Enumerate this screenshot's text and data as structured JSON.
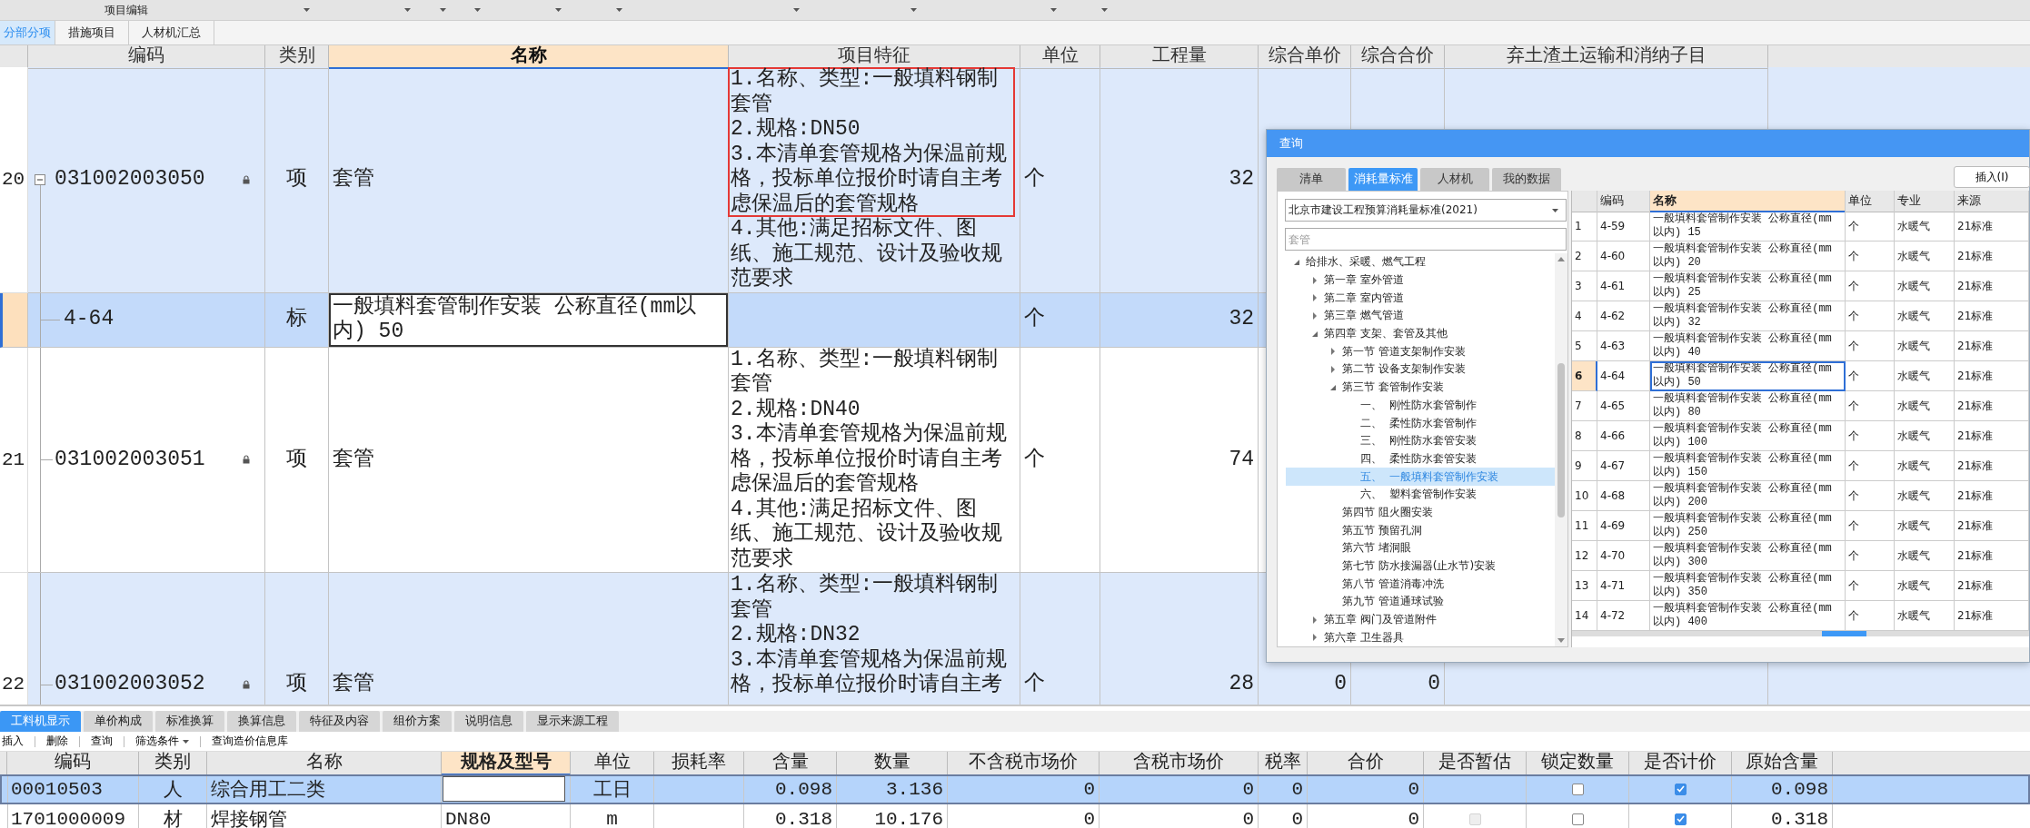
{
  "toolbar": {
    "title": "项目编辑"
  },
  "tabs": [
    {
      "label": "分部分项",
      "selected": true
    },
    {
      "label": "措施项目",
      "selected": false
    },
    {
      "label": "人材机汇总",
      "selected": false
    }
  ],
  "table": {
    "columns": [
      {
        "label": "编码",
        "selected": false
      },
      {
        "label": "类别",
        "selected": false
      },
      {
        "label": "名称",
        "selected": true
      },
      {
        "label": "项目特征",
        "selected": false
      },
      {
        "label": "单位",
        "selected": false
      },
      {
        "label": "工程量",
        "selected": false
      },
      {
        "label": "综合单价",
        "selected": false
      },
      {
        "label": "综合合价",
        "selected": false
      },
      {
        "label": "弃土渣土运输和消纳子目",
        "selected": false
      }
    ],
    "rows": [
      {
        "kind": "item",
        "number": "20",
        "code": "031002003050",
        "expanded": true,
        "locked": true,
        "type": "项",
        "name": "套管",
        "features": [
          {
            "text": "1.名称、类型:一般填料钢制套管",
            "boxed": true
          },
          {
            "text": "2.规格:DN50",
            "boxed": true
          },
          {
            "text": "3.本清单套管规格为保温前规格，投标单位报价时请自主考虑保温后的套管规格",
            "boxed": true
          },
          {
            "text": "4.其他:满足招标文件、图纸、施工规范、设计及验收规范要求",
            "boxed": false
          }
        ],
        "unit": "个",
        "quantity": "32",
        "highlighted": true,
        "selected": false
      },
      {
        "kind": "sub",
        "code": "4-64",
        "type": "标",
        "name": "一般填料套管制作安装 公称直径(mm以内) 50",
        "unit": "个",
        "quantity": "32",
        "highlighted": false,
        "selected": true
      },
      {
        "kind": "item",
        "number": "21",
        "code": "031002003051",
        "locked": true,
        "type": "项",
        "name": "套管",
        "features": [
          {
            "text": "1.名称、类型:一般填料钢制套管",
            "boxed": false
          },
          {
            "text": "2.规格:DN40",
            "boxed": false
          },
          {
            "text": "3.本清单套管规格为保温前规格，投标单位报价时请自主考虑保温后的套管规格",
            "boxed": false
          },
          {
            "text": "4.其他:满足招标文件、图纸、施工规范、设计及验收规范要求",
            "boxed": false
          }
        ],
        "unit": "个",
        "quantity": "74",
        "highlighted": false,
        "selected": false
      },
      {
        "kind": "item",
        "number": "22",
        "code": "031002003052",
        "locked": true,
        "type": "项",
        "name": "套管",
        "features": [
          {
            "text": "1.名称、类型:一般填料钢制套管",
            "boxed": false
          },
          {
            "text": "2.规格:DN32",
            "boxed": false
          },
          {
            "text": "3.本清单套管规格为保温前规格，投标单位报价时请自主考",
            "boxed": false
          }
        ],
        "unit": "个",
        "quantity": "28",
        "unit_price": "0",
        "total_price": "0",
        "highlighted": true,
        "selected": false
      }
    ]
  },
  "query_dialog": {
    "title": "查询",
    "tabs": [
      {
        "label": "清单",
        "selected": false
      },
      {
        "label": "消耗量标准",
        "selected": true
      },
      {
        "label": "人材机",
        "selected": false
      },
      {
        "label": "我的数据",
        "selected": false
      }
    ],
    "insert_button": "插入(I)",
    "library_select": "北京市建设工程预算消耗量标准(2021)",
    "search": {
      "placeholder": "套管"
    },
    "tree": [
      {
        "label": "给排水、采暖、燃气工程",
        "kind": "branch",
        "expanded": true,
        "selected": false,
        "children": [
          {
            "label": "第一章 室外管道",
            "kind": "branch",
            "expanded": false,
            "selected": false
          },
          {
            "label": "第二章 室内管道",
            "kind": "branch",
            "expanded": false,
            "selected": false
          },
          {
            "label": "第三章 燃气管道",
            "kind": "branch",
            "expanded": false,
            "selected": false
          },
          {
            "label": "第四章 支架、套管及其他",
            "kind": "branch",
            "expanded": true,
            "selected": false,
            "children": [
              {
                "label": "第一节 管道支架制作安装",
                "kind": "branch",
                "expanded": false,
                "selected": false
              },
              {
                "label": "第二节 设备支架制作安装",
                "kind": "branch",
                "expanded": false,
                "selected": false
              },
              {
                "label": "第三节 套管制作安装",
                "kind": "branch",
                "expanded": true,
                "selected": false,
                "children": [
                  {
                    "label": "一、  刚性防水套管制作",
                    "kind": "leaf",
                    "selected": false
                  },
                  {
                    "label": "二、  柔性防水套管制作",
                    "kind": "leaf",
                    "selected": false
                  },
                  {
                    "label": "三、  刚性防水套管安装",
                    "kind": "leaf",
                    "selected": false
                  },
                  {
                    "label": "四、  柔性防水套管安装",
                    "kind": "leaf",
                    "selected": false
                  },
                  {
                    "label": "五、  一般填料套管制作安装",
                    "kind": "leaf",
                    "selected": true
                  },
                  {
                    "label": "六、  塑料套管制作安装",
                    "kind": "leaf",
                    "selected": false
                  }
                ]
              },
              {
                "label": "第四节 阻火圈安装",
                "kind": "leaf",
                "selected": false
              },
              {
                "label": "第五节 预留孔洞",
                "kind": "leaf",
                "selected": false
              },
              {
                "label": "第六节 堵洞眼",
                "kind": "leaf",
                "selected": false
              },
              {
                "label": "第七节 防水接漏器(止水节)安装",
                "kind": "leaf",
                "selected": false
              },
              {
                "label": "第八节 管道消毒冲洗",
                "kind": "leaf",
                "selected": false
              },
              {
                "label": "第九节 管道通球试验",
                "kind": "leaf",
                "selected": false
              }
            ]
          },
          {
            "label": "第五章 阀门及管道附件",
            "kind": "branch",
            "expanded": false,
            "selected": false
          },
          {
            "label": "第六章 卫生器具",
            "kind": "branch",
            "expanded": false,
            "selected": false
          }
        ]
      }
    ],
    "table": {
      "columns": [
        {
          "label": "编码",
          "selected": false
        },
        {
          "label": "名称",
          "selected": true
        },
        {
          "label": "单位",
          "selected": false
        },
        {
          "label": "专业",
          "selected": false
        },
        {
          "label": "来源",
          "selected": false
        }
      ],
      "rows": [
        {
          "number": "1",
          "code": "4-59",
          "name": "一般填料套管制作安装 公称直径(mm以内) 15",
          "unit": "个",
          "specialty": "水暖气",
          "source": "21标准",
          "selected": false
        },
        {
          "number": "2",
          "code": "4-60",
          "name": "一般填料套管制作安装 公称直径(mm以内) 20",
          "unit": "个",
          "specialty": "水暖气",
          "source": "21标准",
          "selected": false
        },
        {
          "number": "3",
          "code": "4-61",
          "name": "一般填料套管制作安装 公称直径(mm以内) 25",
          "unit": "个",
          "specialty": "水暖气",
          "source": "21标准",
          "selected": false
        },
        {
          "number": "4",
          "code": "4-62",
          "name": "一般填料套管制作安装 公称直径(mm以内) 32",
          "unit": "个",
          "specialty": "水暖气",
          "source": "21标准",
          "selected": false
        },
        {
          "number": "5",
          "code": "4-63",
          "name": "一般填料套管制作安装 公称直径(mm以内) 40",
          "unit": "个",
          "specialty": "水暖气",
          "source": "21标准",
          "selected": false
        },
        {
          "number": "6",
          "code": "4-64",
          "name": "一般填料套管制作安装 公称直径(mm以内) 50",
          "unit": "个",
          "specialty": "水暖气",
          "source": "21标准",
          "selected": true
        },
        {
          "number": "7",
          "code": "4-65",
          "name": "一般填料套管制作安装 公称直径(mm以内) 80",
          "unit": "个",
          "specialty": "水暖气",
          "source": "21标准",
          "selected": false
        },
        {
          "number": "8",
          "code": "4-66",
          "name": "一般填料套管制作安装 公称直径(mm以内) 100",
          "unit": "个",
          "specialty": "水暖气",
          "source": "21标准",
          "selected": false
        },
        {
          "number": "9",
          "code": "4-67",
          "name": "一般填料套管制作安装 公称直径(mm以内) 150",
          "unit": "个",
          "specialty": "水暖气",
          "source": "21标准",
          "selected": false
        },
        {
          "number": "10",
          "code": "4-68",
          "name": "一般填料套管制作安装 公称直径(mm以内) 200",
          "unit": "个",
          "specialty": "水暖气",
          "source": "21标准",
          "selected": false
        },
        {
          "number": "11",
          "code": "4-69",
          "name": "一般填料套管制作安装 公称直径(mm以内) 250",
          "unit": "个",
          "specialty": "水暖气",
          "source": "21标准",
          "selected": false
        },
        {
          "number": "12",
          "code": "4-70",
          "name": "一般填料套管制作安装 公称直径(mm以内) 300",
          "unit": "个",
          "specialty": "水暖气",
          "source": "21标准",
          "selected": false
        },
        {
          "number": "13",
          "code": "4-71",
          "name": "一般填料套管制作安装 公称直径(mm以内) 350",
          "unit": "个",
          "specialty": "水暖气",
          "source": "21标准",
          "selected": false
        },
        {
          "number": "14",
          "code": "4-72",
          "name": "一般填料套管制作安装 公称直径(mm以内) 400",
          "unit": "个",
          "specialty": "水暖气",
          "source": "21标准",
          "selected": false
        }
      ]
    }
  },
  "detail_panel": {
    "tabs": [
      {
        "label": "工料机显示",
        "selected": true
      },
      {
        "label": "单价构成",
        "selected": false
      },
      {
        "label": "标准换算",
        "selected": false
      },
      {
        "label": "换算信息",
        "selected": false
      },
      {
        "label": "特征及内容",
        "selected": false
      },
      {
        "label": "组价方案",
        "selected": false
      },
      {
        "label": "说明信息",
        "selected": false
      },
      {
        "label": "显示来源工程",
        "selected": false
      }
    ],
    "toolbar": [
      {
        "label": "插入",
        "dropdown": false
      },
      {
        "label": "删除",
        "dropdown": false
      },
      {
        "label": "查询",
        "dropdown": false
      },
      {
        "label": "筛选条件",
        "dropdown": true
      },
      {
        "label": "查询造价信息库",
        "dropdown": false
      }
    ],
    "table": {
      "columns": [
        {
          "label": "编码",
          "selected": false
        },
        {
          "label": "类别",
          "selected": false
        },
        {
          "label": "名称",
          "selected": false
        },
        {
          "label": "规格及型号",
          "selected": true
        },
        {
          "label": "单位",
          "selected": false
        },
        {
          "label": "损耗率",
          "selected": false
        },
        {
          "label": "含量",
          "selected": false
        },
        {
          "label": "数量",
          "selected": false
        },
        {
          "label": "不含税市场价",
          "selected": false
        },
        {
          "label": "含税市场价",
          "selected": false
        },
        {
          "label": "税率",
          "selected": false
        },
        {
          "label": "合价",
          "selected": false
        },
        {
          "label": "是否暂估",
          "selected": false
        },
        {
          "label": "锁定数量",
          "selected": false
        },
        {
          "label": "是否计价",
          "selected": false
        },
        {
          "label": "原始含量",
          "selected": false
        }
      ],
      "rows": [
        {
          "selected": true,
          "cells": [
            "00010503",
            "人",
            "综合用工二类",
            {
              "kind": "input"
            },
            "工日",
            null,
            "0.098",
            "3.136",
            "0",
            "0",
            "0",
            "0",
            null,
            {
              "kind": "checkbox",
              "checked": false,
              "disabled": false
            },
            {
              "kind": "checkbox",
              "checked": true,
              "disabled": false
            },
            "0.098"
          ]
        },
        {
          "selected": false,
          "cells": [
            "1701000009",
            "材",
            "焊接钢管",
            "DN80",
            "m",
            null,
            "0.318",
            "10.176",
            "0",
            "0",
            "0",
            "0",
            {
              "kind": "checkbox",
              "checked": false,
              "disabled": true
            },
            {
              "kind": "checkbox",
              "checked": false,
              "disabled": false
            },
            {
              "kind": "checkbox",
              "checked": true,
              "disabled": false
            },
            "0.318"
          ]
        }
      ]
    }
  }
}
